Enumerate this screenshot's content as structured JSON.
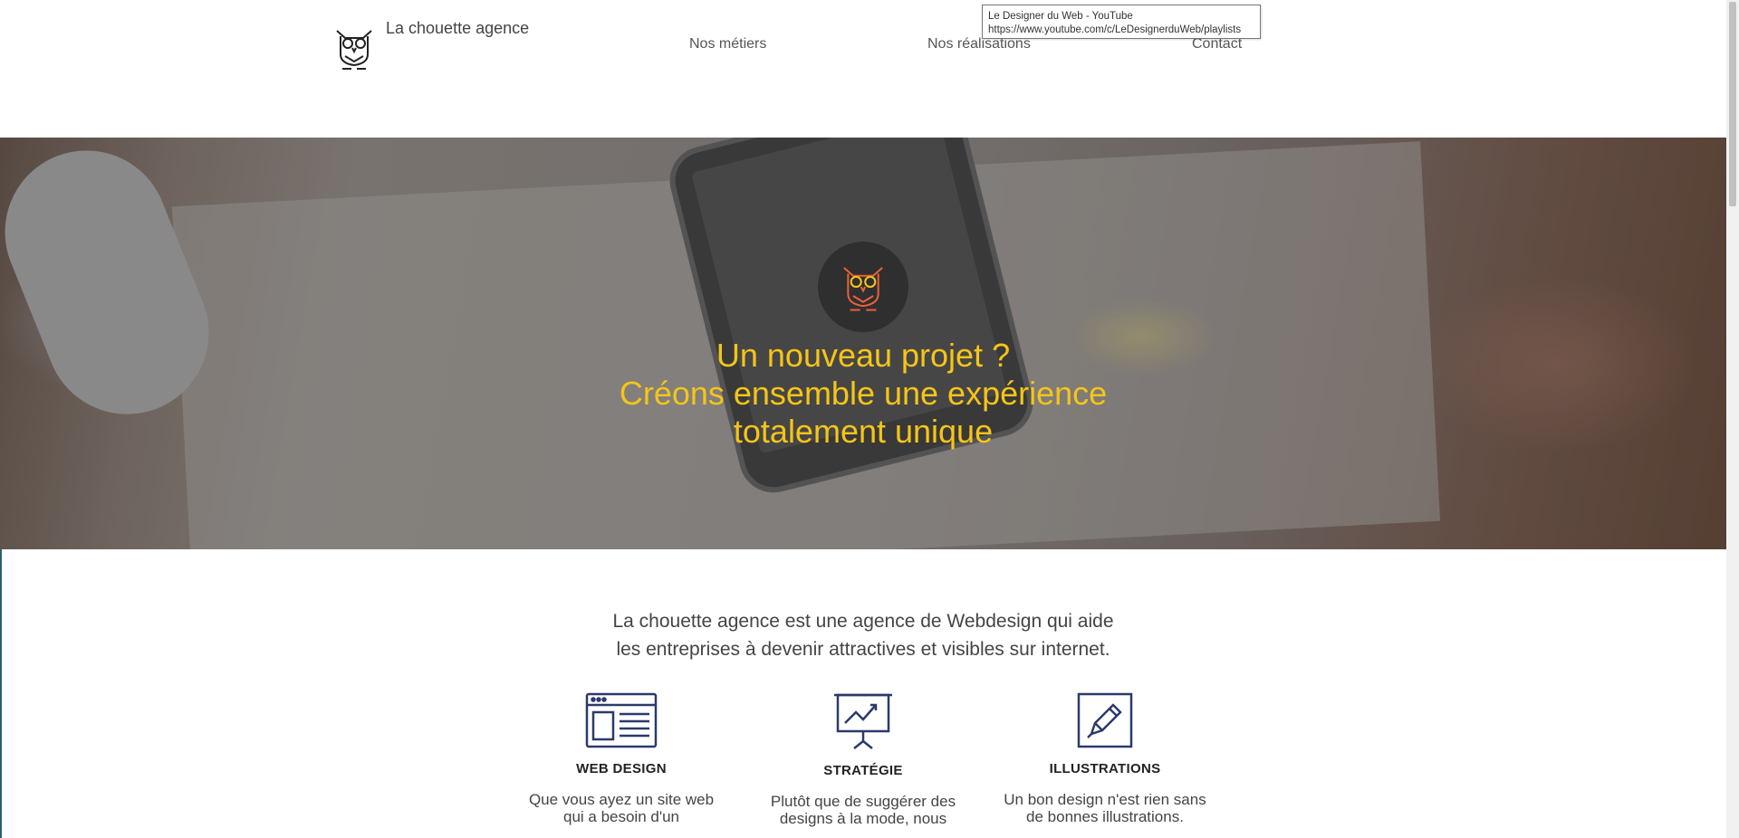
{
  "header": {
    "brand": "La chouette agence",
    "nav": [
      "Nos métiers",
      "Nos réalisations",
      "Contact"
    ]
  },
  "tooltip": {
    "line1": "Le Designer du Web - YouTube",
    "line2": "https://www.youtube.com/c/LeDesignerduWeb/playlists"
  },
  "hero": {
    "lines": [
      "Un nouveau projet ?",
      "Créons ensemble une expérience",
      "totalement unique"
    ],
    "accent_color": "#f5c518",
    "logo_accent": "#e8623a"
  },
  "intro": {
    "lines": [
      "La chouette agence est une agence de Webdesign qui aide",
      "les entreprises à devenir attractives et visibles sur internet."
    ]
  },
  "features": [
    {
      "icon": "web-design-icon",
      "title": "WEB DESIGN",
      "desc": [
        "Que vous ayez un site web",
        "qui a besoin d'un"
      ]
    },
    {
      "icon": "strategy-icon",
      "title": "STRATÉGIE",
      "desc": [
        "Plutôt que de suggérer des",
        "designs à la mode, nous"
      ]
    },
    {
      "icon": "illustration-icon",
      "title": "ILLUSTRATIONS",
      "desc": [
        "Un bon design n'est rien sans",
        "de bonnes illustrations."
      ]
    }
  ],
  "colors": {
    "icon_stroke": "#2c3a6b",
    "text": "#444444"
  }
}
